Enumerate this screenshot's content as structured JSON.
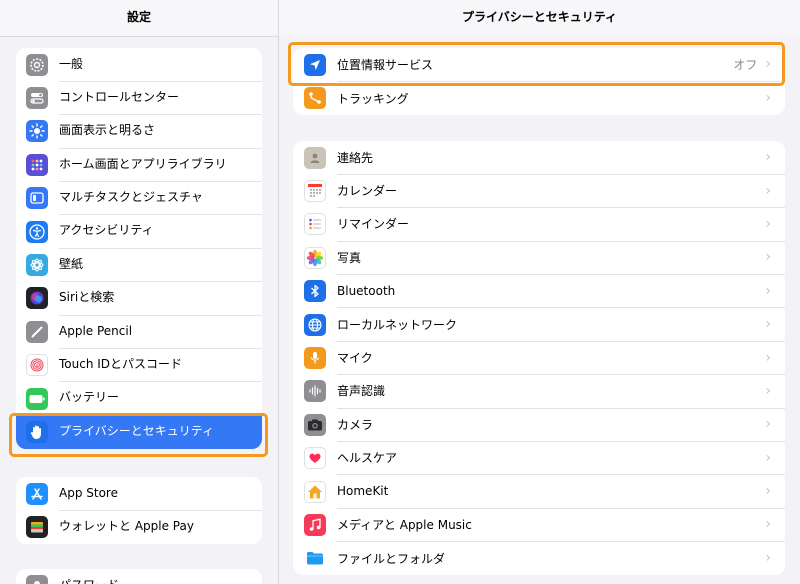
{
  "sidebar": {
    "title": "設定",
    "group1": [
      {
        "label": "一般",
        "icon": "gear-icon",
        "color": "#8e8e93"
      },
      {
        "label": "コントロールセンター",
        "icon": "toggles-icon",
        "color": "#8e8e93"
      },
      {
        "label": "画面表示と明るさ",
        "icon": "sun-icon",
        "color": "#3478f6"
      },
      {
        "label": "ホーム画面とアプリライブラリ",
        "icon": "app-grid-icon",
        "color": "#5b4fd6"
      },
      {
        "label": "マルチタスクとジェスチャ",
        "icon": "multitask-icon",
        "color": "#3478f6"
      },
      {
        "label": "アクセシビリティ",
        "icon": "accessibility-icon",
        "color": "#1e7cf2"
      },
      {
        "label": "壁紙",
        "icon": "wallpaper-icon",
        "color": "#35a9e0"
      },
      {
        "label": "Siriと検索",
        "icon": "siri-icon",
        "color": "#222222"
      },
      {
        "label": "Apple Pencil",
        "icon": "pencil-icon",
        "color": "#8e8e93"
      },
      {
        "label": "Touch IDとパスコード",
        "icon": "fingerprint-icon",
        "color": "#ffffff"
      },
      {
        "label": "バッテリー",
        "icon": "battery-icon",
        "color": "#34c759"
      },
      {
        "label": "プライバシーとセキュリティ",
        "icon": "hand-icon",
        "color": "#1e6fe8",
        "selected": true
      }
    ],
    "group2": [
      {
        "label": "App Store",
        "icon": "app-store-icon",
        "color": "#1e90ff"
      },
      {
        "label": "ウォレットと Apple Pay",
        "icon": "wallet-icon",
        "color": "#222222"
      }
    ],
    "group3": [
      {
        "label": "パスワード",
        "icon": "key-icon",
        "color": "#8e8e93"
      }
    ]
  },
  "main": {
    "title": "プライバシーとセキュリティ",
    "group1": [
      {
        "label": "位置情報サービス",
        "value": "オフ",
        "icon": "location-arrow-icon",
        "color": "#1e6fe8"
      },
      {
        "label": "トラッキング",
        "value": "",
        "icon": "tracking-icon",
        "color": "#f39a1e"
      }
    ],
    "group2": [
      {
        "label": "連絡先",
        "icon": "contacts-icon",
        "color": "#c9c3b8"
      },
      {
        "label": "カレンダー",
        "icon": "calendar-icon",
        "color": "#ffffff"
      },
      {
        "label": "リマインダー",
        "icon": "reminders-icon",
        "color": "#ffffff"
      },
      {
        "label": "写真",
        "icon": "photos-icon",
        "color": "#ffffff"
      },
      {
        "label": "Bluetooth",
        "icon": "bluetooth-icon",
        "color": "#1e6fe8"
      },
      {
        "label": "ローカルネットワーク",
        "icon": "globe-icon",
        "color": "#1e6fe8"
      },
      {
        "label": "マイク",
        "icon": "microphone-icon",
        "color": "#f39a1e"
      },
      {
        "label": "音声認識",
        "icon": "waveform-icon",
        "color": "#8e8e93"
      },
      {
        "label": "カメラ",
        "icon": "camera-icon",
        "color": "#8e8e93"
      },
      {
        "label": "ヘルスケア",
        "icon": "heart-icon",
        "color": "#ffffff"
      },
      {
        "label": "HomeKit",
        "icon": "home-icon",
        "color": "#ffffff"
      },
      {
        "label": "メディアと Apple Music",
        "icon": "music-icon",
        "color": "#f53b57"
      },
      {
        "label": "ファイルとフォルダ",
        "icon": "folder-icon",
        "color": "#ffffff"
      }
    ]
  },
  "chevron": "›",
  "highlight_color": "#f39a1e"
}
